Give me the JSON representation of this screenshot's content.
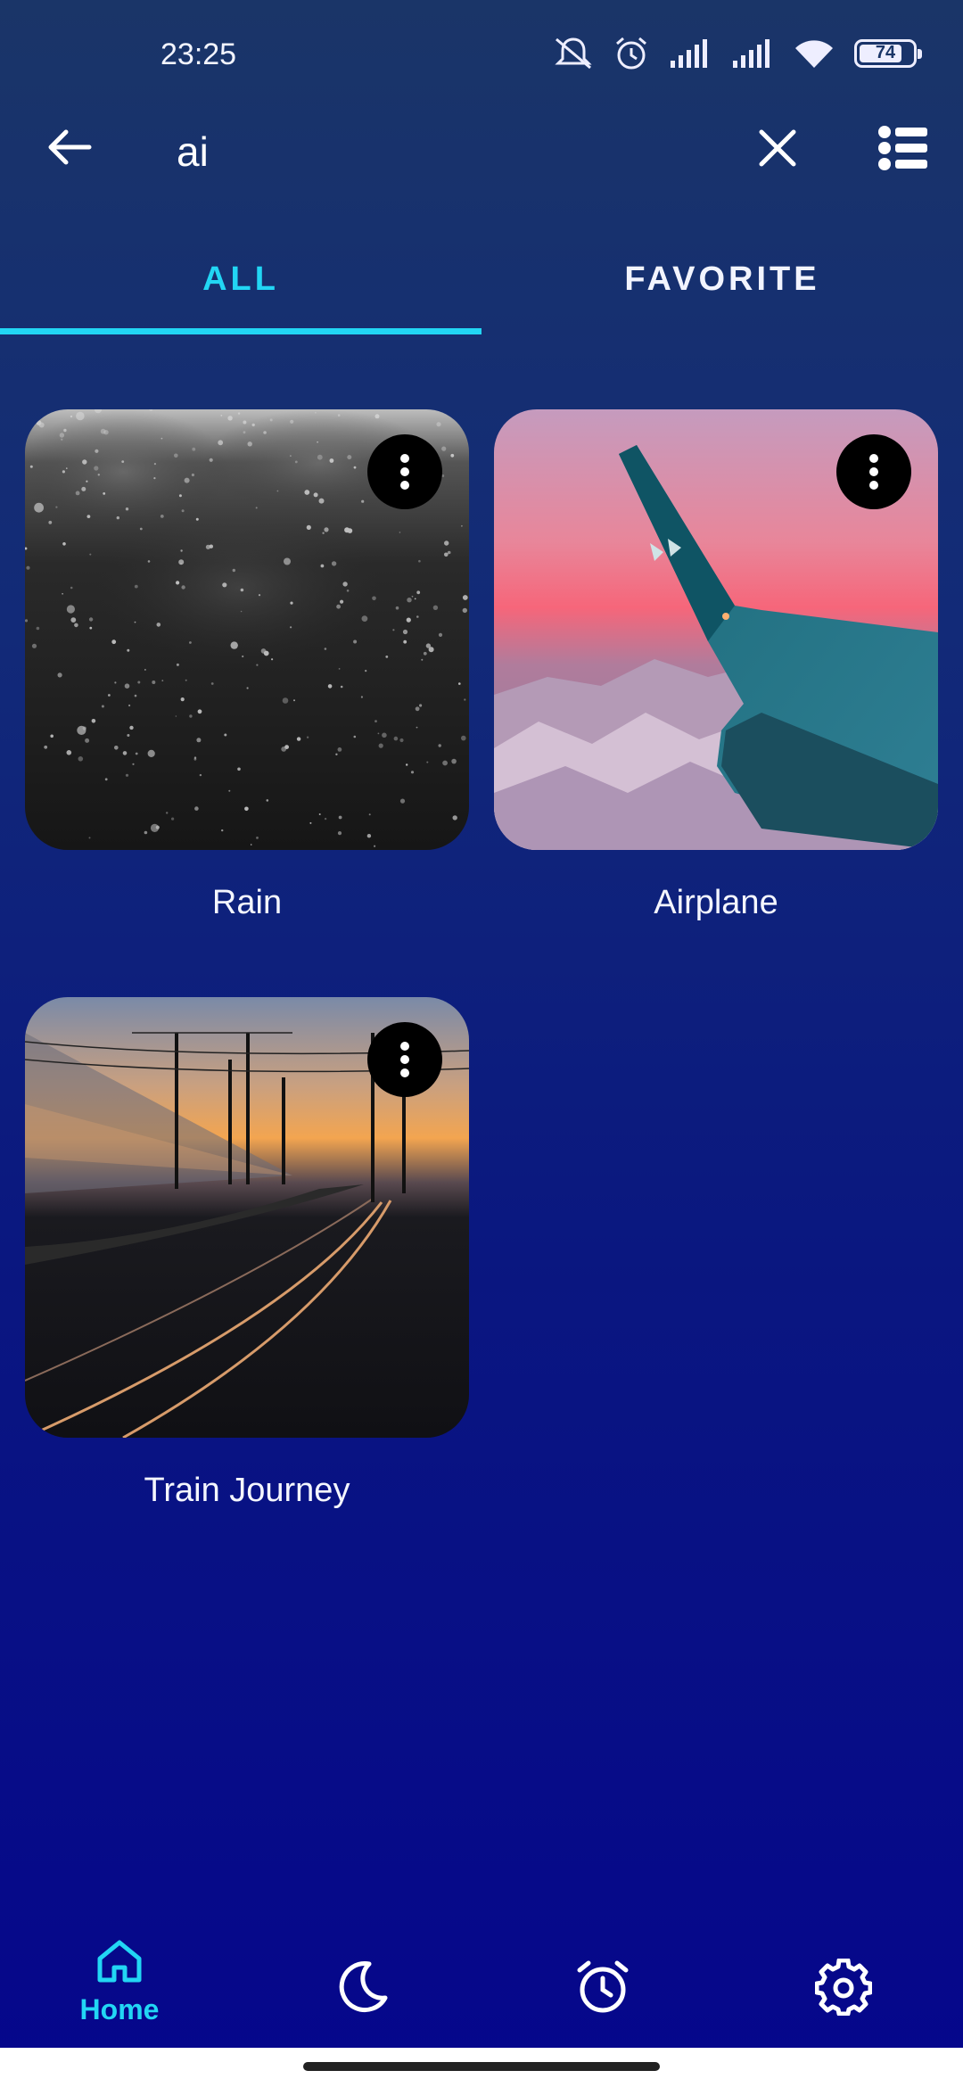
{
  "status_bar": {
    "time": "23:25",
    "battery_level": "74",
    "icons": [
      "mute-icon",
      "alarm-icon",
      "signal-icon",
      "signal-icon",
      "wifi-icon",
      "battery-icon"
    ]
  },
  "search": {
    "query": "ai",
    "back_icon": "arrow-left-icon",
    "clear_icon": "close-icon",
    "list_icon": "list-icon"
  },
  "tabs": [
    {
      "label": "ALL",
      "selected": true
    },
    {
      "label": "FAVORITE",
      "selected": false
    }
  ],
  "results": [
    {
      "title": "Rain",
      "menu_icon": "more-vert-icon"
    },
    {
      "title": "Airplane",
      "menu_icon": "more-vert-icon"
    },
    {
      "title": "Train Journey",
      "menu_icon": "more-vert-icon"
    }
  ],
  "bottom_nav": [
    {
      "label": "Home",
      "icon": "home-icon",
      "selected": true
    },
    {
      "label": "",
      "icon": "moon-icon",
      "selected": false
    },
    {
      "label": "",
      "icon": "alarm-clock-icon",
      "selected": false
    },
    {
      "label": "",
      "icon": "gear-icon",
      "selected": false
    }
  ],
  "colors": {
    "accent": "#22d6f4",
    "background_top": "#1a3568",
    "background_bottom": "#05068c"
  }
}
